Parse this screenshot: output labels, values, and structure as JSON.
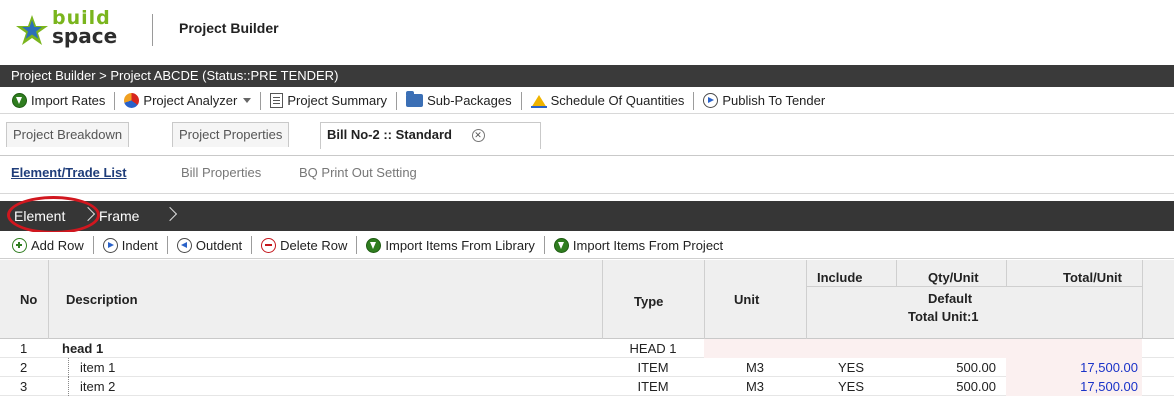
{
  "header": {
    "logo_top": "build",
    "logo_bottom": "space",
    "app_title": "Project Builder"
  },
  "breadcrumb": "Project Builder > Project ABCDE (Status::PRE TENDER)",
  "main_toolbar": {
    "import_rates": "Import Rates",
    "project_analyzer": "Project Analyzer",
    "project_summary": "Project Summary",
    "sub_packages": "Sub-Packages",
    "schedule_of_quantities": "Schedule Of Quantities",
    "publish_to_tender": "Publish To Tender"
  },
  "tabs": {
    "project_breakdown": "Project Breakdown",
    "project_properties": "Project Properties",
    "bill": "Bill No-2 :: Standard"
  },
  "sublinks": {
    "element_trade_list": "Element/Trade List",
    "bill_properties": "Bill Properties",
    "bq_print_out_setting": "BQ Print Out Setting"
  },
  "element_bar": {
    "element": "Element",
    "frame": "Frame"
  },
  "actions": {
    "add_row": "Add Row",
    "indent": "Indent",
    "outdent": "Outdent",
    "delete_row": "Delete Row",
    "import_library": "Import Items From Library",
    "import_project": "Import Items From Project"
  },
  "grid": {
    "columns": {
      "no": "No",
      "description": "Description",
      "type": "Type",
      "unit": "Unit",
      "include": "Include",
      "qty_unit": "Qty/Unit",
      "total_unit": "Total/Unit",
      "default": "Default",
      "total_unit_count": "Total Unit:1"
    },
    "rows": [
      {
        "no": "1",
        "description": "head 1",
        "type": "HEAD 1",
        "unit": "",
        "include": "",
        "qty": "",
        "total": ""
      },
      {
        "no": "2",
        "description": "item 1",
        "type": "ITEM",
        "unit": "M3",
        "include": "YES",
        "qty": "500.00",
        "total": "17,500.00"
      },
      {
        "no": "3",
        "description": "item 2",
        "type": "ITEM",
        "unit": "M3",
        "include": "YES",
        "qty": "500.00",
        "total": "17,500.00"
      }
    ]
  },
  "colors": {
    "logo_green": "#7ab51d",
    "dark_bar": "#3a3a3a",
    "highlight_red": "#d1171f",
    "total_blue": "#1a33c8"
  }
}
